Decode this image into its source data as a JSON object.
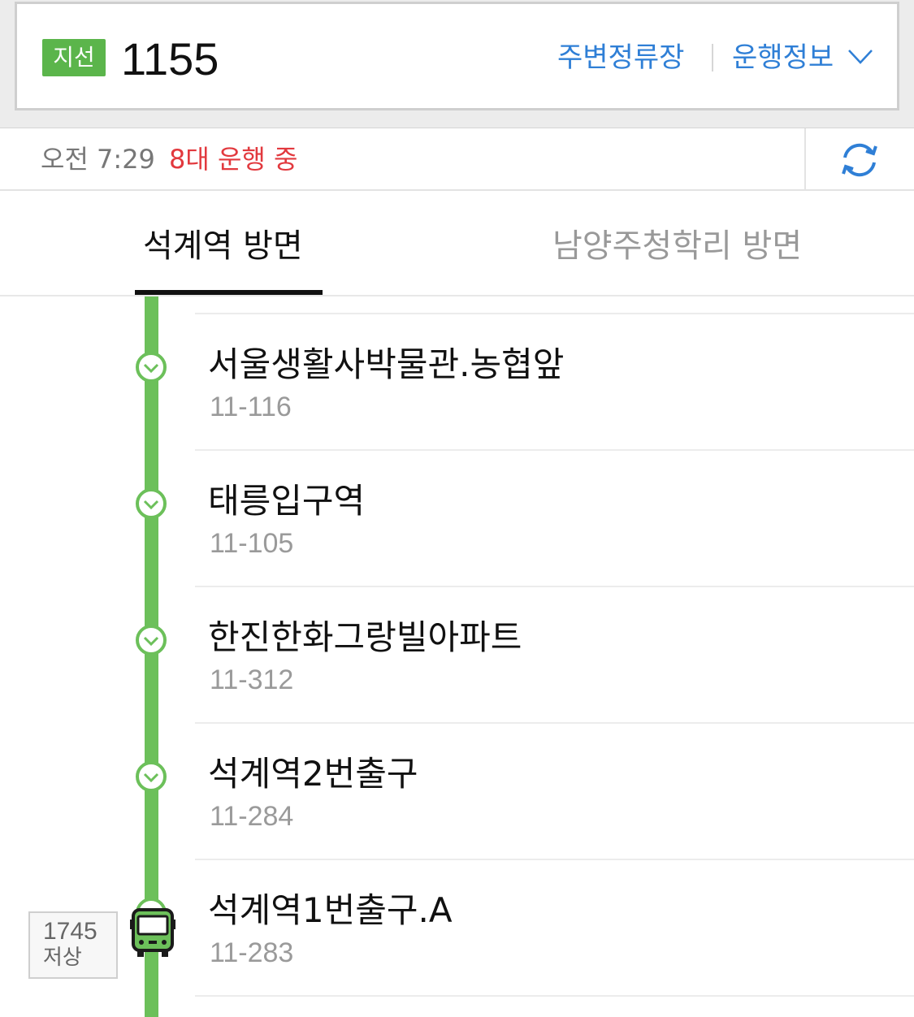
{
  "header": {
    "route_type": "지선",
    "route_number": "1155",
    "nearby_stops_label": "주변정류장",
    "route_info_label": "운행정보",
    "colors": {
      "route_type_badge": "#5bb54b",
      "link": "#2f7fd6"
    },
    "icons": {
      "dropdown": "chevron-down-icon"
    }
  },
  "status": {
    "time": "오전 7:29",
    "running_count": "8대 운행 중",
    "colors": {
      "running_count": "#e2393e"
    },
    "icons": {
      "refresh": "refresh-icon"
    }
  },
  "tabs": [
    {
      "label": "석계역 방면",
      "active": true
    },
    {
      "label": "남양주청학리 방면",
      "active": false
    }
  ],
  "stops": [
    {
      "name": "서울생활사박물관.농협앞",
      "id": "11-116"
    },
    {
      "name": "태릉입구역",
      "id": "11-105"
    },
    {
      "name": "한진한화그랑빌아파트",
      "id": "11-312"
    },
    {
      "name": "석계역2번출구",
      "id": "11-284"
    },
    {
      "name": "석계역1번출구.A",
      "id": "11-283"
    }
  ],
  "bus": {
    "plate": "1745",
    "type": "저상",
    "icons": {
      "bus": "bus-icon"
    }
  },
  "line_color": "#6cc05a"
}
